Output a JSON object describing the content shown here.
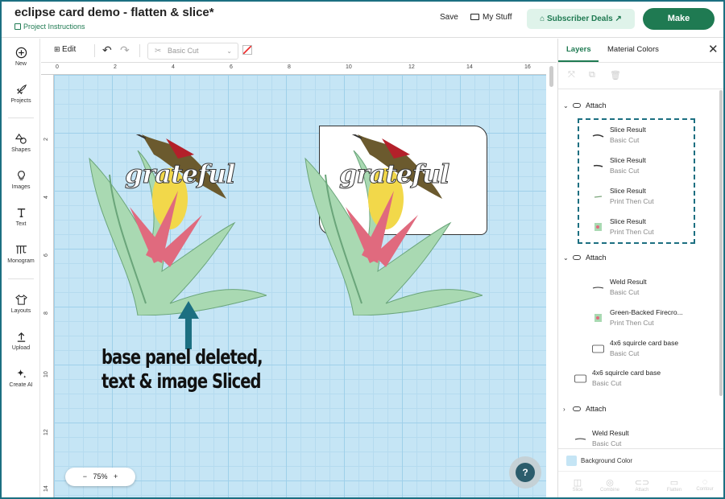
{
  "header": {
    "title": "eclipse card demo - flatten & slice*",
    "project_link": "Project Instructions",
    "save": "Save",
    "my_stuff": "My Stuff",
    "subscriber_deals": "Subscriber Deals",
    "subscriber_arrow": "↗",
    "make": "Make"
  },
  "nav": [
    {
      "label": "New",
      "icon": "plus-circle-icon"
    },
    {
      "label": "Projects",
      "icon": "rocket-icon"
    },
    {
      "label": "Shapes",
      "icon": "shapes-icon"
    },
    {
      "label": "Images",
      "icon": "lightbulb-icon"
    },
    {
      "label": "Text",
      "icon": "text-icon"
    },
    {
      "label": "Monogram",
      "icon": "monogram-icon"
    },
    {
      "label": "Layouts",
      "icon": "shirt-icon"
    },
    {
      "label": "Upload",
      "icon": "upload-icon"
    },
    {
      "label": "Create AI",
      "icon": "sparkle-icon"
    }
  ],
  "toolbar": {
    "edit": "Edit",
    "operation": "Basic Cut"
  },
  "canvas": {
    "ruler_top": [
      "0",
      "2",
      "4",
      "6",
      "8",
      "10",
      "12",
      "14",
      "16"
    ],
    "ruler_left": [
      "2",
      "4",
      "6",
      "8",
      "10",
      "12",
      "14"
    ],
    "art_text": "grateful",
    "annotation_line1": "base panel deleted,",
    "annotation_line2": "text & image Sliced",
    "zoom": "75%",
    "zoom_minus": "−",
    "zoom_plus": "+",
    "help": "?"
  },
  "panel": {
    "tab_layers": "Layers",
    "tab_material_colors": "Material Colors",
    "groups": [
      {
        "label": "Attach",
        "expanded": true,
        "layers": [
          {
            "name": "Slice Result",
            "type": "Basic Cut"
          },
          {
            "name": "Slice Result",
            "type": "Basic Cut"
          },
          {
            "name": "Slice Result",
            "type": "Print Then Cut"
          },
          {
            "name": "Slice Result",
            "type": "Print Then Cut"
          }
        ]
      },
      {
        "label": "Attach",
        "expanded": true,
        "layers": [
          {
            "name": "Weld Result",
            "type": "Basic Cut"
          },
          {
            "name": "Green-Backed Firecro...",
            "type": "Print Then Cut"
          },
          {
            "name": "4x6 squircle card base",
            "type": "Basic Cut"
          }
        ]
      }
    ],
    "loose_layer": {
      "name": "4x6 squircle card base",
      "type": "Basic Cut"
    },
    "group3": {
      "label": "Attach",
      "expanded": false
    },
    "last_layer": {
      "name": "Weld Result",
      "type": "Basic Cut"
    },
    "background_color_label": "Background Color",
    "background_color": "#c5e5f5",
    "actions": [
      "Slice",
      "Combine",
      "Attach",
      "Flatten",
      "Contour"
    ]
  },
  "colors": {
    "accent": "#1f7a52",
    "frame": "#1c6f81",
    "canvas": "#c5e5f5"
  }
}
